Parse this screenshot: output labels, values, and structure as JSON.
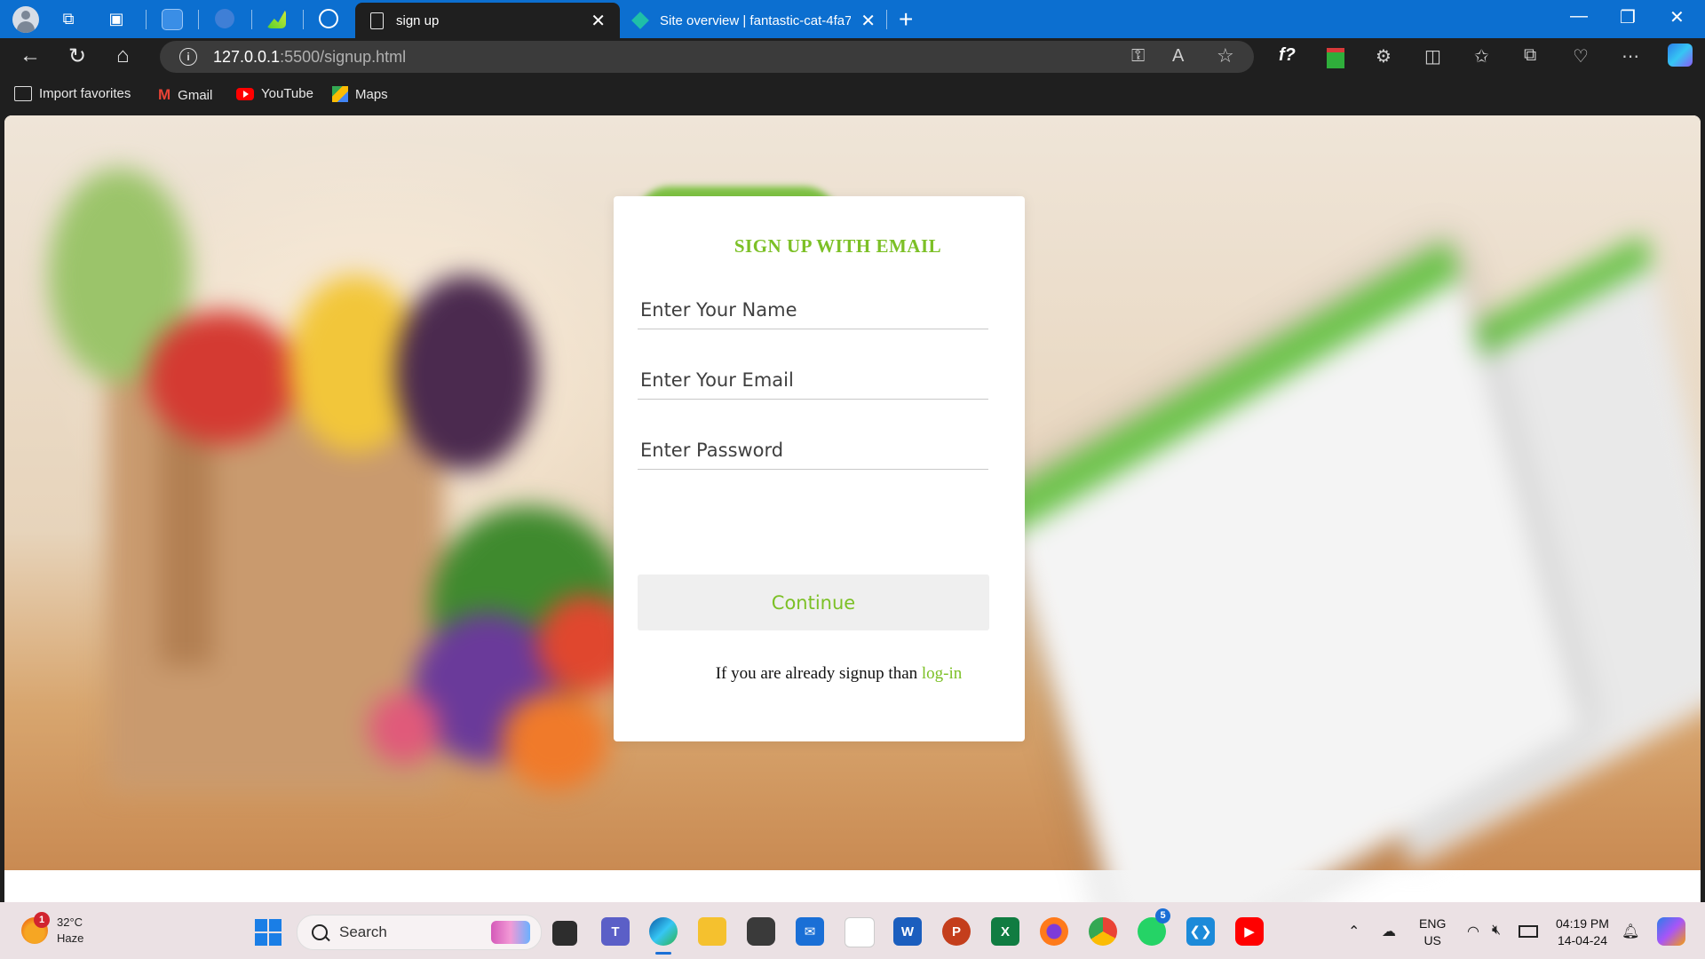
{
  "browser": {
    "tabs": [
      {
        "title": "sign up",
        "active": true
      },
      {
        "title": "Site overview | fantastic-cat-4fa7",
        "active": false
      }
    ],
    "address": {
      "host": "127.0.0.1",
      "path": ":5500/signup.html"
    },
    "favorites": [
      {
        "label": "Import favorites",
        "icon": "import-icon"
      },
      {
        "label": "Gmail",
        "icon": "gmail-icon"
      },
      {
        "label": "YouTube",
        "icon": "youtube-icon"
      },
      {
        "label": "Maps",
        "icon": "maps-icon"
      }
    ]
  },
  "page": {
    "title": "SIGN UP WITH EMAIL",
    "name_placeholder": "Enter Your Name",
    "email_placeholder": "Enter Your Email",
    "password_placeholder": "Enter Password",
    "continue_label": "Continue",
    "already_text": "If you are already signup than ",
    "login_link": "log-in",
    "accent_color": "#7cc026"
  },
  "taskbar": {
    "weather_temp": "32°C",
    "weather_desc": "Haze",
    "weather_badge": "1",
    "search_label": "Search",
    "whatsapp_badge": "5",
    "lang_top": "ENG",
    "lang_bottom": "US",
    "time": "04:19 PM",
    "date": "14-04-24"
  }
}
